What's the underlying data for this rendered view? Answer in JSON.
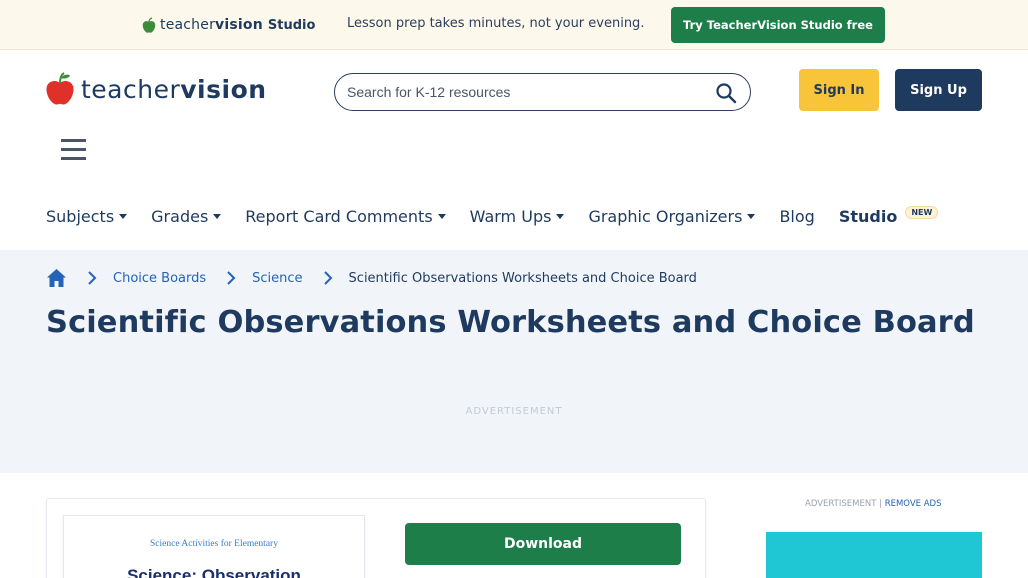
{
  "promo": {
    "logo_word_light": "teacher",
    "logo_word_bold": "vision",
    "logo_studio": "Studio",
    "text": "Lesson prep takes minutes, not your evening.",
    "button": "Try TeacherVision Studio free"
  },
  "header": {
    "logo_word_light": "teacher",
    "logo_word_bold": "vision",
    "search_placeholder": "Search for K-12 resources",
    "signin": "Sign In",
    "signup": "Sign Up"
  },
  "nav": {
    "items": [
      {
        "label": "Subjects",
        "dropdown": true
      },
      {
        "label": "Grades",
        "dropdown": true
      },
      {
        "label": "Report Card Comments",
        "dropdown": true
      },
      {
        "label": "Warm Ups",
        "dropdown": true
      },
      {
        "label": "Graphic Organizers",
        "dropdown": true
      },
      {
        "label": "Blog",
        "dropdown": false
      }
    ],
    "studio": "Studio",
    "studio_badge": "NEW"
  },
  "breadcrumb": {
    "items": [
      "Choice Boards",
      "Science"
    ],
    "current": "Scientific Observations Worksheets and Choice Board"
  },
  "page": {
    "title": "Scientific Observations Worksheets and Choice Board",
    "ad_label": "ADVERTISEMENT"
  },
  "resource": {
    "thumb_subtitle": "Science Activities for Elementary",
    "thumb_title": "Science: Observation",
    "download": "Download"
  },
  "sidebar": {
    "ad_label": "ADVERTISEMENT |",
    "remove_ads": "REMOVE ADS"
  },
  "colors": {
    "navy": "#1f3a5f",
    "green": "#1e7e4a",
    "yellow": "#f8c43a",
    "link": "#2563b8",
    "apple_red": "#e0302a",
    "leaf_green": "#3c8d3a"
  }
}
